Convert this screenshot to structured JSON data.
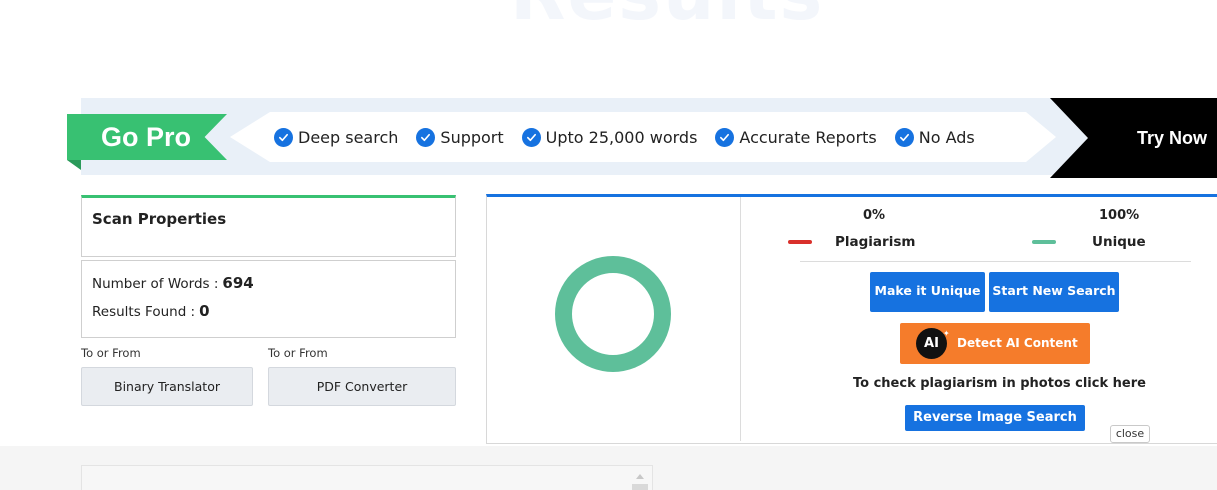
{
  "header": {
    "faded_title": "Results"
  },
  "pro_banner": {
    "go_pro_label": "Go Pro",
    "features": [
      "Deep search",
      "Support",
      "Upto 25,000 words",
      "Accurate Reports",
      "No Ads"
    ],
    "try_now_label": "Try Now",
    "colors": {
      "go_pro": "#38c172",
      "check": "#1672e0",
      "try_now_bg": "#000000",
      "ribbon_bg": "#e9f0f8"
    }
  },
  "scan_properties": {
    "title": "Scan Properties",
    "words_label": "Number of Words :",
    "words_value": "694",
    "results_label": "Results Found :",
    "results_value": "0"
  },
  "tools": [
    {
      "caption": "To or From",
      "button_label": "Binary Translator"
    },
    {
      "caption": "To or From",
      "button_label": "PDF Converter"
    }
  ],
  "results": {
    "plagiarism_pct": "0%",
    "unique_pct": "100%",
    "plagiarism_label": "Plagiarism",
    "unique_label": "Unique",
    "plagiarism_fraction": 0,
    "unique_fraction": 1,
    "colors": {
      "plagiarism": "#d9302b",
      "unique": "#5ebf9a",
      "accent": "#1672e0"
    },
    "make_unique_label": "Make it Unique",
    "start_new_search_label": "Start New Search",
    "detect_ai_badge": "AI",
    "detect_ai_label": "Detect AI Content",
    "photo_text": "To check plagiarism in photos click here",
    "reverse_image_label": "Reverse Image Search",
    "close_label": "close"
  }
}
